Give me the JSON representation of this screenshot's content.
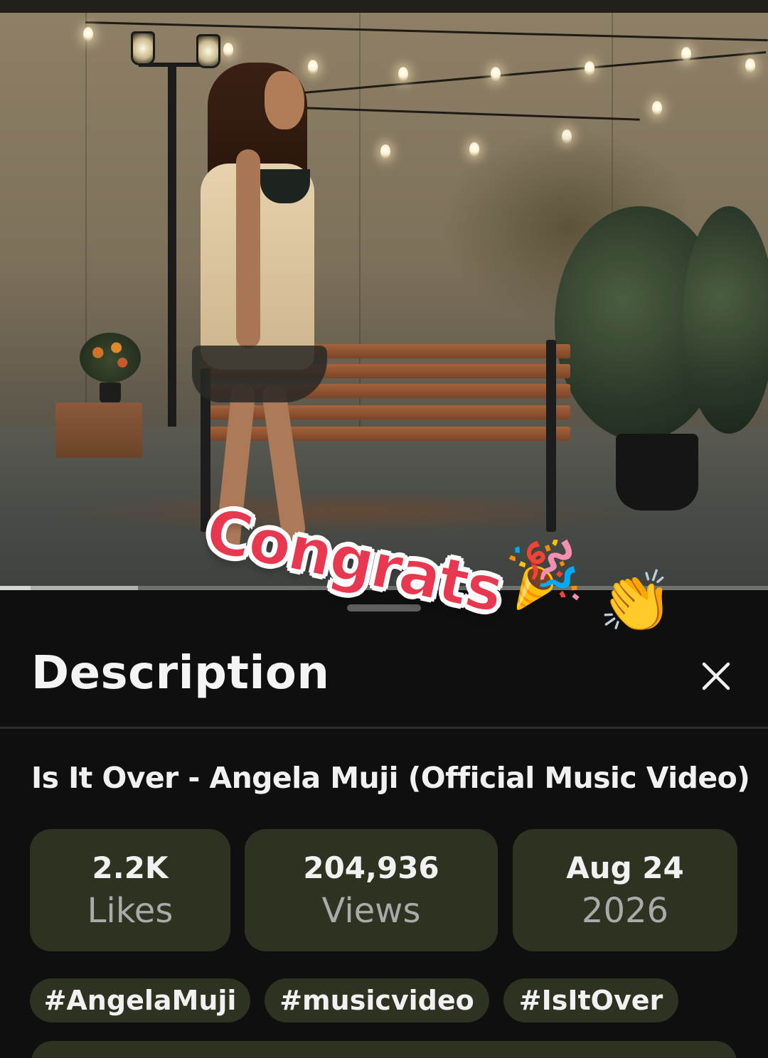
{
  "sticker": {
    "text": "Congrats",
    "emoji_party": "🎉",
    "emoji_clap": "👏"
  },
  "player": {
    "progress_fraction": 0.04,
    "buffered_fraction": 0.18
  },
  "sheet": {
    "title": "Description",
    "close_icon": "close-icon"
  },
  "video": {
    "title": "Is It Over - Angela Muji (Official Music Video)"
  },
  "stats": [
    {
      "value": "2.2K",
      "label": "Likes"
    },
    {
      "value": "204,936",
      "label": "Views"
    },
    {
      "value": "Aug 24",
      "label": "2026"
    }
  ],
  "hashtags": [
    "#AngelaMuji",
    "#musicvideo",
    "#IsItOver"
  ],
  "colors": {
    "sheet_bg": "#0f0f0f",
    "chip_bg": "#2e3220",
    "sticker_red": "#e8384f"
  }
}
